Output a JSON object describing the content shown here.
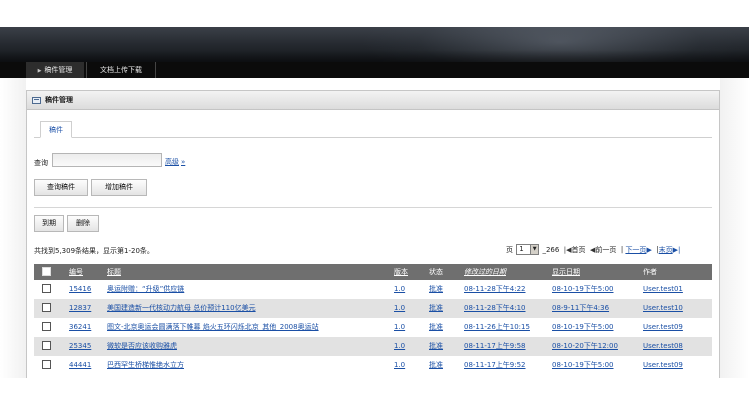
{
  "nav": {
    "items": [
      {
        "label": "稿件管理",
        "active": true
      },
      {
        "label": "文档上传下载",
        "active": false
      }
    ]
  },
  "panel": {
    "title": "稿件管理"
  },
  "tab": {
    "label": "稿件"
  },
  "search": {
    "label": "查询",
    "value": "",
    "advanced_label": "高级",
    "advanced_arrow": "»"
  },
  "buttons": {
    "query": "查询稿件",
    "add": "增加稿件",
    "expire": "到期",
    "delete": "删除"
  },
  "summary": "共找到5,309条结果，显示第1-20条。",
  "pager": {
    "page_prefix": "页",
    "current_page": "1",
    "total_pages": "_266",
    "first": "首页",
    "prev": "前一页",
    "next": "下一页",
    "last": "末页"
  },
  "table": {
    "columns": {
      "id": "编号",
      "title": "标题",
      "version": "版本",
      "status": "状态",
      "modified": "修改过的日期",
      "display": "显示日期",
      "author": "作者"
    },
    "rows": [
      {
        "id": "15416",
        "title": "奥运附赠：“升级”供应链",
        "version": "1.0",
        "status": "批准",
        "modified": "08-11-28下午4:22",
        "display": "08-10-19下午5:00",
        "author": "User.test01"
      },
      {
        "id": "12837",
        "title": "美国建造新一代核动力航母 总价预计110亿美元",
        "version": "1.0",
        "status": "批准",
        "modified": "08-11-28下午4:10",
        "display": "08-9-11下午4:36",
        "author": "User.test10"
      },
      {
        "id": "36241",
        "title": "图文-北京奥运会圆满落下帷幕 焰火五环闪烁北京_其他_2008奥运站",
        "version": "1.0",
        "status": "批准",
        "modified": "08-11-26上午10:15",
        "display": "08-10-19下午5:00",
        "author": "User.test09"
      },
      {
        "id": "25345",
        "title": "微软是否应该收购雅虎",
        "version": "1.0",
        "status": "批准",
        "modified": "08-11-17上午9:58",
        "display": "08-10-20下午12:00",
        "author": "User.test08"
      },
      {
        "id": "44441",
        "title": "巴西罕生桥梯惟绝水立方",
        "version": "1.0",
        "status": "批准",
        "modified": "08-11-17上午9:52",
        "display": "08-10-19下午5:00",
        "author": "User.test09"
      }
    ]
  },
  "icons": {
    "nav_arrow": "triangle-right-icon",
    "panel": "window-icon",
    "dropdown": "chevron-down-icon",
    "first": "first-page-icon",
    "prev": "prev-page-icon",
    "next": "next-page-icon",
    "last": "last-page-icon"
  },
  "colors": {
    "nav_bg": "#0b0b0b",
    "link": "#1a4fa5",
    "grid_header": "#6f6f6f",
    "alt_row": "#e2e2e2"
  }
}
